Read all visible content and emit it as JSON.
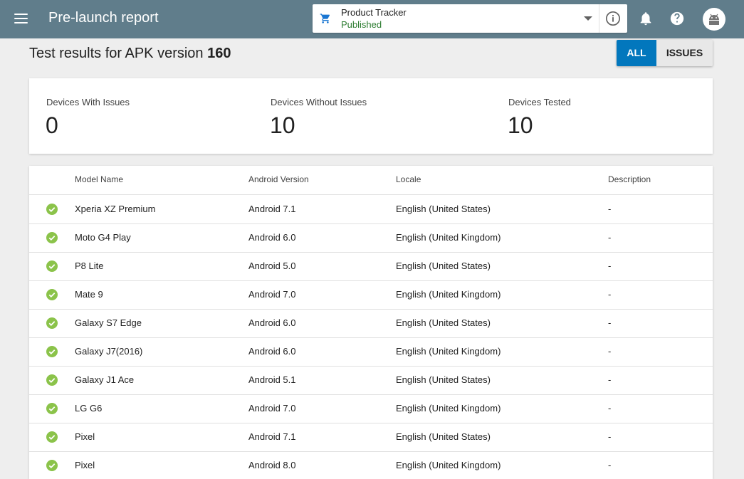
{
  "topbar": {
    "title": "Pre-launch report",
    "app": {
      "name": "Product Tracker",
      "status": "Published"
    }
  },
  "page": {
    "heading_prefix": "Test results for APK version",
    "apk_version": "160",
    "filters": {
      "all": "ALL",
      "issues": "ISSUES",
      "selected": "ALL"
    }
  },
  "summary": {
    "with_issues": {
      "label": "Devices With Issues",
      "value": "0"
    },
    "without_issues": {
      "label": "Devices Without Issues",
      "value": "10"
    },
    "tested": {
      "label": "Devices Tested",
      "value": "10"
    }
  },
  "table": {
    "headers": {
      "model": "Model Name",
      "android": "Android Version",
      "locale": "Locale",
      "description": "Description"
    },
    "rows": [
      {
        "model": "Xperia XZ Premium",
        "android": "Android 7.1",
        "locale": "English (United States)",
        "description": "-"
      },
      {
        "model": "Moto G4 Play",
        "android": "Android 6.0",
        "locale": "English (United Kingdom)",
        "description": "-"
      },
      {
        "model": "P8 Lite",
        "android": "Android 5.0",
        "locale": "English (United States)",
        "description": "-"
      },
      {
        "model": "Mate 9",
        "android": "Android 7.0",
        "locale": "English (United Kingdom)",
        "description": "-"
      },
      {
        "model": "Galaxy S7 Edge",
        "android": "Android 6.0",
        "locale": "English (United States)",
        "description": "-"
      },
      {
        "model": "Galaxy J7(2016)",
        "android": "Android 6.0",
        "locale": "English (United Kingdom)",
        "description": "-"
      },
      {
        "model": "Galaxy J1 Ace",
        "android": "Android 5.1",
        "locale": "English (United States)",
        "description": "-"
      },
      {
        "model": "LG G6",
        "android": "Android 7.0",
        "locale": "English (United Kingdom)",
        "description": "-"
      },
      {
        "model": "Pixel",
        "android": "Android 7.1",
        "locale": "English (United States)",
        "description": "-"
      },
      {
        "model": "Pixel",
        "android": "Android 8.0",
        "locale": "English (United Kingdom)",
        "description": "-"
      }
    ]
  },
  "icons": {
    "menu": "menu-icon",
    "app": "shopping-cart-icon",
    "info": "info-icon",
    "notifications": "bell-icon",
    "help": "help-icon",
    "account": "android-avatar-icon",
    "row_status": "check-circle-icon"
  },
  "colors": {
    "topbar": "#607d8b",
    "accent": "#0277bd",
    "published": "#2e7d32",
    "check": "#8bc34a"
  }
}
